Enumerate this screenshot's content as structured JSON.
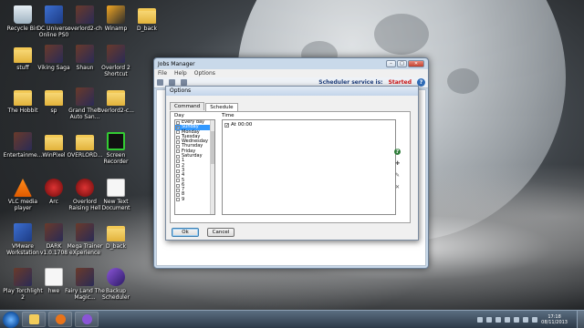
{
  "desktop": {
    "icons": [
      {
        "label": "Recycle Bin",
        "kind": "bin"
      },
      {
        "label": "DC Universe Online PS0",
        "kind": "app"
      },
      {
        "label": "overlord2-ch",
        "kind": "game"
      },
      {
        "label": "Winamp",
        "kind": "winamp"
      },
      {
        "label": "D_back",
        "kind": "folder"
      },
      {
        "label": "stuff",
        "kind": "folder"
      },
      {
        "label": "Viking Saga",
        "kind": "game"
      },
      {
        "label": "Shaun",
        "kind": "game"
      },
      {
        "label": "Overlord 2 Shortcut",
        "kind": "game"
      },
      {
        "label": "The Hobbit",
        "kind": "folder"
      },
      {
        "label": "sp",
        "kind": "folder"
      },
      {
        "label": "Grand Theft Auto San...",
        "kind": "game"
      },
      {
        "label": "overlord2-c...",
        "kind": "folder"
      },
      {
        "label": "Entertainme...",
        "kind": "game"
      },
      {
        "label": "WinPixel",
        "kind": "folder"
      },
      {
        "label": "OVERLORD...",
        "kind": "folder"
      },
      {
        "label": "Screen Recorder",
        "kind": "green"
      },
      {
        "label": "VLC media player",
        "kind": "vlc"
      },
      {
        "label": "Arc",
        "kind": "red"
      },
      {
        "label": "Overlord Raising Hell",
        "kind": "red"
      },
      {
        "label": "New Text Document",
        "kind": "doc"
      },
      {
        "label": "VMware Workstation",
        "kind": "app"
      },
      {
        "label": "DARK v1.0.1708",
        "kind": "game"
      },
      {
        "label": "Mega Trainer eXperience",
        "kind": "game"
      },
      {
        "label": "D_back",
        "kind": "folder"
      },
      {
        "label": "Play Torchlight 2",
        "kind": "game"
      },
      {
        "label": "hwe",
        "kind": "doc"
      },
      {
        "label": "Fairy Land The Magic...",
        "kind": "game"
      },
      {
        "label": "Backup Scheduler",
        "kind": "purple"
      }
    ]
  },
  "jobs_window": {
    "title": "Jobs Manager",
    "menu": [
      "File",
      "Help",
      "Options"
    ],
    "status_text": "Scheduler service is:",
    "status_value": "Started"
  },
  "options_dialog": {
    "title": "Options",
    "tabs": [
      "Command",
      "Schedule"
    ],
    "active_tab": "Schedule",
    "day_label": "Day",
    "time_label": "Time",
    "days": [
      {
        "label": "Every day",
        "checked": false
      },
      {
        "label": "Sunday",
        "checked": true,
        "selected": true
      },
      {
        "label": "Monday",
        "checked": false
      },
      {
        "label": "Tuesday",
        "checked": false
      },
      {
        "label": "Wednesday",
        "checked": false
      },
      {
        "label": "Thursday",
        "checked": false
      },
      {
        "label": "Friday",
        "checked": false
      },
      {
        "label": "Saturday",
        "checked": false
      },
      {
        "label": "1",
        "checked": false
      },
      {
        "label": "2",
        "checked": false
      },
      {
        "label": "3",
        "checked": false
      },
      {
        "label": "4",
        "checked": false
      },
      {
        "label": "5",
        "checked": false
      },
      {
        "label": "6",
        "checked": false
      },
      {
        "label": "7",
        "checked": false
      },
      {
        "label": "8",
        "checked": false
      },
      {
        "label": "9",
        "checked": false
      }
    ],
    "times": [
      {
        "label": "At 00:00",
        "checked": true
      }
    ],
    "ok_label": "Ok",
    "cancel_label": "Cancel"
  },
  "taskbar": {
    "time": "17:18",
    "date": "08/11/2013"
  },
  "colors": {
    "selection": "#3399ff",
    "status_started": "#cc1111"
  }
}
